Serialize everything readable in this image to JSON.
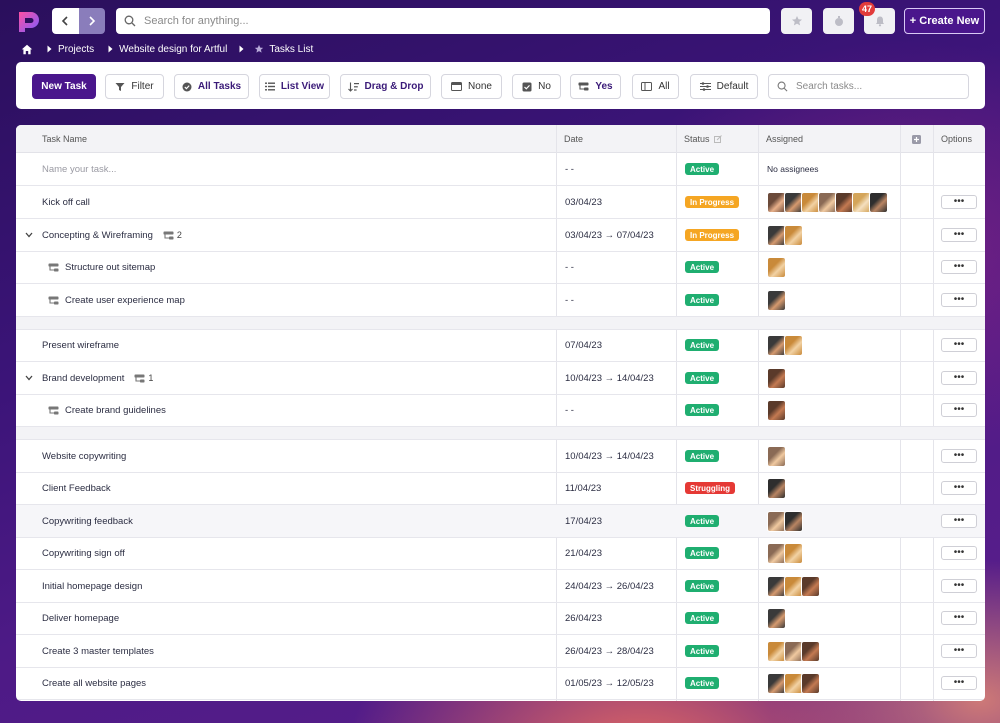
{
  "topbar": {
    "search_placeholder": "Search for anything...",
    "notification_count": "47",
    "create_new_label": "+ Create New"
  },
  "breadcrumb": {
    "items": [
      "Projects",
      "Website design for Artful",
      "Tasks List"
    ]
  },
  "toolbar": {
    "new_task": "New Task",
    "filter": "Filter",
    "all_tasks": "All Tasks",
    "list_view": "List View",
    "drag_drop": "Drag & Drop",
    "none": "None",
    "no": "No",
    "yes": "Yes",
    "all": "All",
    "default": "Default",
    "search_placeholder": "Search tasks..."
  },
  "table": {
    "columns": {
      "task_name": "Task Name",
      "date": "Date",
      "status": "Status",
      "assigned": "Assigned",
      "options": "Options"
    },
    "new_task_placeholder": "Name your task...",
    "new_task_date": "- -",
    "new_task_status": "Active",
    "new_task_assigned": "No assignees",
    "options_label": "•••",
    "rows": [
      {
        "name": "Kick off call",
        "date": "03/04/23",
        "status": "In Progress",
        "sub": false,
        "expand": false,
        "count": "",
        "avatars": 7
      },
      {
        "name": "Concepting & Wireframing",
        "date": "03/04/23 → 07/04/23",
        "status": "In Progress",
        "sub": false,
        "expand": true,
        "count": "2",
        "avatars": 2
      },
      {
        "name": "Structure out sitemap",
        "date": "- -",
        "status": "Active",
        "sub": true,
        "expand": false,
        "count": "",
        "avatars": 1
      },
      {
        "name": "Create user experience map",
        "date": "- -",
        "status": "Active",
        "sub": true,
        "expand": false,
        "count": "",
        "avatars": 1
      },
      {
        "name": "Present wireframe",
        "date": "07/04/23",
        "status": "Active",
        "sub": false,
        "expand": false,
        "count": "",
        "avatars": 2
      },
      {
        "name": "Brand development",
        "date": "10/04/23 → 14/04/23",
        "status": "Active",
        "sub": false,
        "expand": true,
        "count": "1",
        "avatars": 1
      },
      {
        "name": "Create brand guidelines",
        "date": "- -",
        "status": "Active",
        "sub": true,
        "expand": false,
        "count": "",
        "avatars": 1
      },
      {
        "name": "Website copywriting",
        "date": "10/04/23 → 14/04/23",
        "status": "Active",
        "sub": false,
        "expand": false,
        "count": "",
        "avatars": 1
      },
      {
        "name": "Client Feedback",
        "date": "11/04/23",
        "status": "Struggling",
        "sub": false,
        "expand": false,
        "count": "",
        "avatars": 1
      },
      {
        "name": "Copywriting feedback",
        "date": "17/04/23",
        "status": "Active",
        "sub": false,
        "expand": false,
        "count": "",
        "avatars": 2
      },
      {
        "name": "Copywriting sign off",
        "date": "21/04/23",
        "status": "Active",
        "sub": false,
        "expand": false,
        "count": "",
        "avatars": 2
      },
      {
        "name": "Initial homepage design",
        "date": "24/04/23 → 26/04/23",
        "status": "Active",
        "sub": false,
        "expand": false,
        "count": "",
        "avatars": 3
      },
      {
        "name": "Deliver homepage",
        "date": "26/04/23",
        "status": "Active",
        "sub": false,
        "expand": false,
        "count": "",
        "avatars": 1
      },
      {
        "name": "Create 3 master templates",
        "date": "26/04/23 → 28/04/23",
        "status": "Active",
        "sub": false,
        "expand": false,
        "count": "",
        "avatars": 3
      },
      {
        "name": "Create all website pages",
        "date": "01/05/23 → 12/05/23",
        "status": "Active",
        "sub": false,
        "expand": false,
        "count": "",
        "avatars": 3
      }
    ]
  },
  "status_colors": {
    "Active": "#1fae70",
    "In Progress": "#f5a623",
    "Struggling": "#e53935"
  },
  "brand": {
    "accent": "#4a168c"
  }
}
